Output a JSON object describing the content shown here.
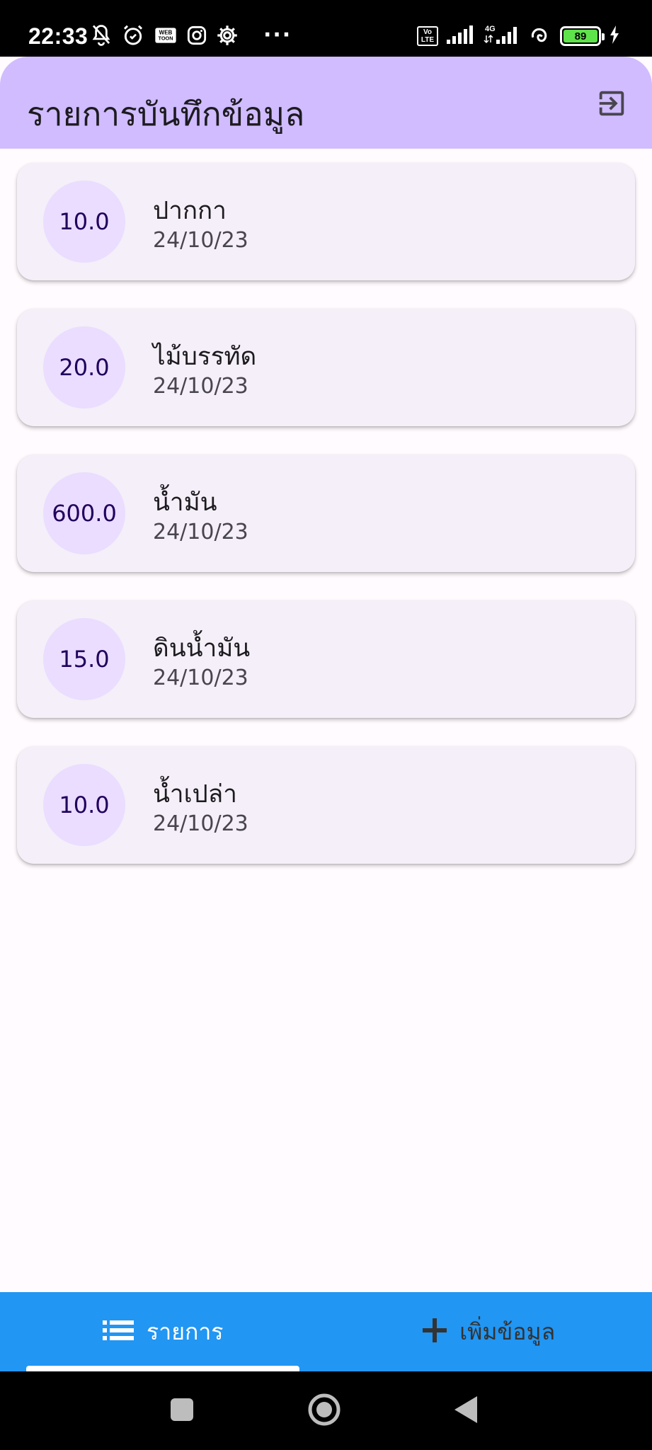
{
  "status_bar": {
    "time": "22:33",
    "icons_left": [
      "notifications-off-icon",
      "alarm-icon",
      "webtoon-icon",
      "instagram-icon",
      "settings-icon"
    ],
    "overflow": "···",
    "volte": "Vo LTE",
    "network": "4G",
    "battery": "89"
  },
  "app_bar": {
    "title": "รายการบันทึกข้อมูล",
    "color": "#d0bcff"
  },
  "items": [
    {
      "amount": "10.0",
      "title": "ปากกา",
      "date": "24/10/23"
    },
    {
      "amount": "20.0",
      "title": "ไม้บรรทัด",
      "date": "24/10/23"
    },
    {
      "amount": "600.0",
      "title": "น้ำมัน",
      "date": "24/10/23"
    },
    {
      "amount": "15.0",
      "title": "ดินน้ำมัน",
      "date": "24/10/23"
    },
    {
      "amount": "10.0",
      "title": "น้ำเปล่า",
      "date": "24/10/23"
    }
  ],
  "bottom_tabs": {
    "list_label": "รายการ",
    "add_label": "เพิ่มข้อมูล",
    "selected": "list",
    "color": "#2196f3"
  },
  "nav_bar": {
    "icons": [
      "recents-icon",
      "home-icon",
      "back-icon"
    ]
  }
}
